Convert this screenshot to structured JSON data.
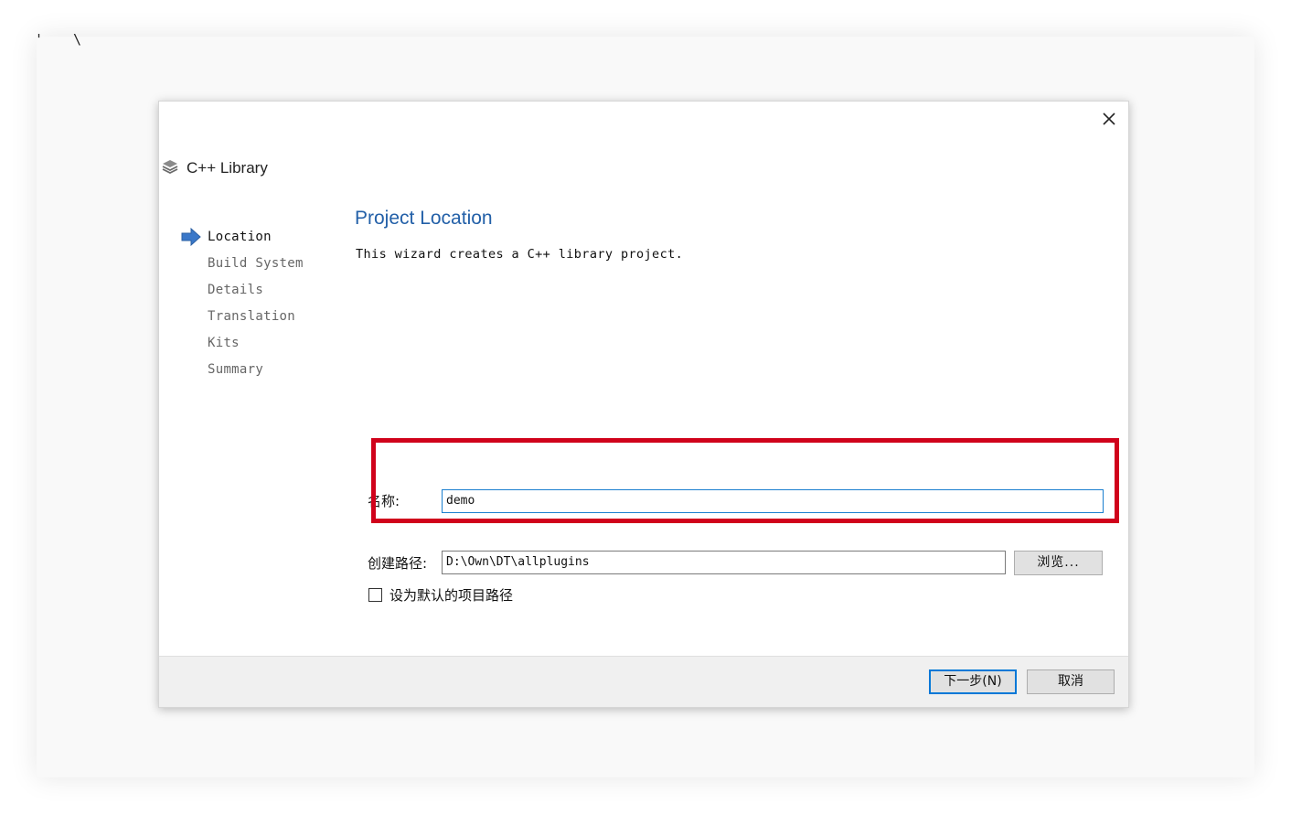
{
  "background": {
    "corner_text": "' \\"
  },
  "dialog": {
    "close_icon": "close-icon",
    "wizard_icon": "library-stack-icon",
    "wizard_title": "C++ Library",
    "steps": [
      {
        "label": "Location",
        "active": true
      },
      {
        "label": "Build System",
        "active": false
      },
      {
        "label": "Details",
        "active": false
      },
      {
        "label": "Translation",
        "active": false
      },
      {
        "label": "Kits",
        "active": false
      },
      {
        "label": "Summary",
        "active": false
      }
    ],
    "page_title": "Project Location",
    "page_description": "This wizard creates a C++ library project.",
    "form": {
      "name_label": "名称:",
      "name_value": "demo",
      "path_label": "创建路径:",
      "path_value": "D:\\Own\\DT\\allplugins",
      "browse_label": "浏览...",
      "default_checkbox_label": "设为默认的项目路径",
      "default_checkbox_checked": false
    },
    "footer": {
      "next_label": "下一步(N)",
      "cancel_label": "取消"
    }
  },
  "colors": {
    "title_blue": "#2360a8",
    "highlight_red": "#d0021b",
    "focus_blue": "#0078d7"
  }
}
